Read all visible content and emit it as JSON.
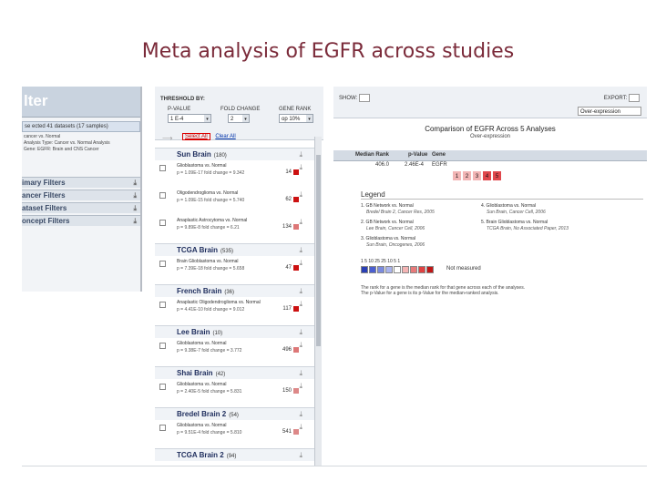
{
  "slide": {
    "title": "Meta analysis of EGFR across studies"
  },
  "left_panel": {
    "header": "lter",
    "banner": "se ected 41 datasets (17  samples)",
    "desc_lines": [
      "cancer vs. Normal",
      "Analysis Type: Cancer vs. Normal Analysis",
      "Gene: EGFR: Brain and CNS Cancer"
    ],
    "filters": [
      {
        "label": "imary Filters"
      },
      {
        "label": "ancer Filters"
      },
      {
        "label": "ataset Filters"
      },
      {
        "label": "oncept Filters"
      }
    ]
  },
  "mid_panel": {
    "threshold_label": "THRESHOLD BY:",
    "pvalue_label": "P-VALUE",
    "fold_label": "FOLD CHANGE",
    "gene_label": "GENE RANK",
    "pvalue_val": "1 E-4",
    "fold_val": "2",
    "gene_val": "op 10%",
    "select_all": "Select All",
    "clear_all": "Clear All",
    "studies": [
      {
        "name": "Sun Brain",
        "count": "(180)",
        "rows": [
          {
            "t1": "Glioblastoma vs. Normal",
            "t2": "p = 1.09E-17    fold change = 9.342",
            "rank": "14",
            "color": "#cc1111"
          },
          {
            "t1": "Oligodendroglioma vs. Normal",
            "t2": "p = 1.09E-15    fold change = 5.740",
            "rank": "62",
            "color": "#cc1111"
          },
          {
            "t1": "Anaplastic Astrocytoma vs. Normal",
            "t2": "p = 9.89E-8    fold change = 6.21",
            "rank": "134",
            "color": "#dd7777"
          }
        ]
      },
      {
        "name": "TCGA Brain",
        "count": "(535)",
        "rows": [
          {
            "t1": "Brain Glioblastoma vs. Normal",
            "t2": "p = 7.39E-18    fold change = 5.658",
            "rank": "47",
            "color": "#cc1111"
          }
        ]
      },
      {
        "name": "French Brain",
        "count": "(36)",
        "rows": [
          {
            "t1": "Anaplastic Oligodendroglioma vs. Normal",
            "t2": "p = 4.41E-10    fold change = 9.012",
            "rank": "117",
            "color": "#cc1111"
          }
        ]
      },
      {
        "name": "Lee Brain",
        "count": "(10)",
        "rows": [
          {
            "t1": "Glioblastoma vs. Normal",
            "t2": "p = 9.38E-7    fold change = 3.772",
            "rank": "496",
            "color": "#dd7777"
          }
        ]
      },
      {
        "name": "Shai Brain",
        "count": "(42)",
        "rows": [
          {
            "t1": "Glioblastoma vs. Normal",
            "t2": "p = 2.40E-5    fold change = 5.831",
            "rank": "150",
            "color": "#dd8888"
          }
        ]
      },
      {
        "name": "Bredel Brain 2",
        "count": "(54)",
        "rows": [
          {
            "t1": "Glioblastoma vs. Normal",
            "t2": "p = 9.51E-4    fold change = 5.810",
            "rank": "541",
            "color": "#dd8888"
          }
        ]
      },
      {
        "name": "TCGA Brain 2",
        "count": "(94)",
        "rows": []
      }
    ]
  },
  "right_panel": {
    "show_label": "SHOW:",
    "export_label": "EXPORT:",
    "selopt": "Over-expression",
    "title": "Comparison of EGFR Across 5 Analyses",
    "subtitle": "Over-expression",
    "table_headers": [
      "Median Rank",
      "p-Value",
      "Gene"
    ],
    "row_values": [
      "406.0",
      "2.46E-4",
      "EGFR"
    ],
    "heat_cells": [
      {
        "label": "1",
        "color": "#f2b5b5"
      },
      {
        "label": "2",
        "color": "#f2b5b5"
      },
      {
        "label": "3",
        "color": "#f2b5b5"
      },
      {
        "label": "4",
        "color": "#e0474c"
      },
      {
        "label": "5",
        "color": "#e0474c"
      }
    ],
    "legend_title": "Legend",
    "legend_items": [
      {
        "l1": "1. GB Network vs. Normal",
        "l2": "Bredel Brain 2, Cancer Res, 2005"
      },
      {
        "l1": "2. GB Network vs. Normal",
        "l2": "Lee Brain, Cancer Cell, 2006"
      },
      {
        "l1": "3. Glioblastoma vs. Normal",
        "l2": "Sun Brain, Oncogenes, 2006"
      },
      {
        "l1": "4. Glioblastoma vs. Normal",
        "l2": "Sun Brain, Cancer Cell, 2006"
      },
      {
        "l1": "5. Brain Glioblastoma vs. Normal",
        "l2": "TCGA Brain, No Associated Paper, 2013"
      }
    ],
    "scale_labels": "1  5  10  25     25  10  5  1",
    "scale_colors": [
      "#2a3fb5",
      "#4b5fd0",
      "#7b8be0",
      "#aab4ee",
      "#ffffff",
      "#f4b4b4",
      "#e87a7a",
      "#e04242",
      "#c01616"
    ],
    "not_measured": "Not measured",
    "footnote_lines": [
      "The rank for a gene is the median rank for that gene across each of the analyses.",
      "The p-Value for a gene is its p-Value for the median-ranked analysis."
    ]
  }
}
